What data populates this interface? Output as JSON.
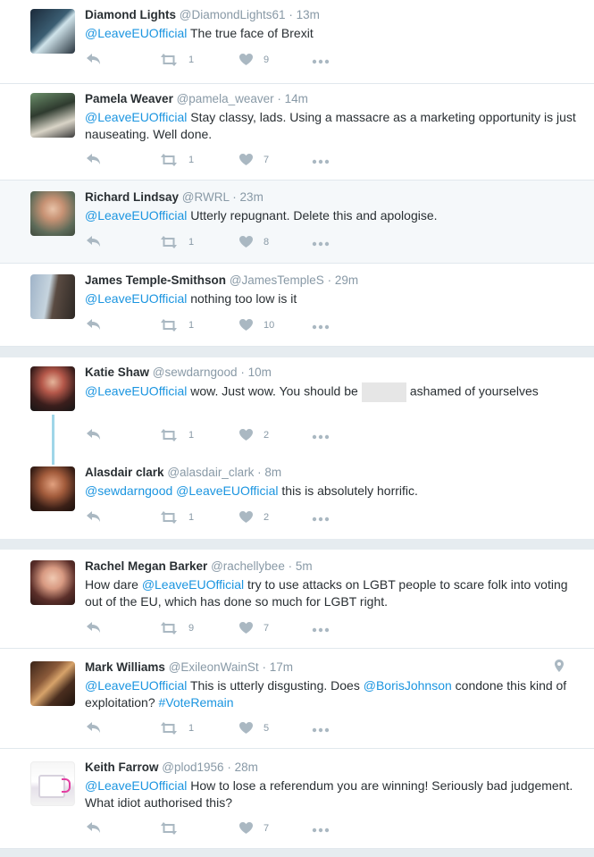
{
  "tweets": [
    {
      "name": "Diamond Lights",
      "handle": "@DiamondLights61",
      "time": "13m",
      "mention": "@LeaveEUOfficial",
      "text": " The true face of Brexit",
      "retweets": "1",
      "likes": "9"
    },
    {
      "name": "Pamela Weaver",
      "handle": "@pamela_weaver",
      "time": "14m",
      "mention": "@LeaveEUOfficial",
      "text": " Stay classy, lads. Using a massacre as a marketing opportunity is just nauseating. Well done.",
      "retweets": "1",
      "likes": "7"
    },
    {
      "name": "Richard Lindsay",
      "handle": "@RWRL",
      "time": "23m",
      "mention": "@LeaveEUOfficial",
      "text": " Utterly repugnant. Delete this and apologise.",
      "retweets": "1",
      "likes": "8"
    },
    {
      "name": "James Temple-Smithson",
      "handle": "@JamesTempleS",
      "time": "29m",
      "mention": "@LeaveEUOfficial",
      "text": " nothing too low is it",
      "retweets": "1",
      "likes": "10"
    },
    {
      "name": "Katie Shaw",
      "handle": "@sewdarngood",
      "time": "10m",
      "mention": "@LeaveEUOfficial",
      "text_a": " wow. Just wow. You should be",
      "text_b": "ashamed of yourselves",
      "retweets": "1",
      "likes": "2"
    },
    {
      "name": "Alasdair clark",
      "handle": "@alasdair_clark",
      "time": "8m",
      "mention1": "@sewdarngood",
      "mention2": "@LeaveEUOfficial",
      "text": " this is absolutely horrific.",
      "retweets": "1",
      "likes": "2"
    },
    {
      "name": "Rachel Megan Barker",
      "handle": "@rachellybee",
      "time": "5m",
      "text_a": "How dare ",
      "mention": "@LeaveEUOfficial",
      "text_b": " try to use attacks on LGBT people to scare folk into voting out of the EU, which has done so much for LGBT right.",
      "retweets": "9",
      "likes": "7"
    },
    {
      "name": "Mark Williams",
      "handle": "@ExileonWainSt",
      "time": "17m",
      "mention": "@LeaveEUOfficial",
      "text_a": " This is utterly disgusting. Does ",
      "mention2": "@BorisJohnson",
      "text_b": " condone this kind of exploitation? ",
      "hashtag": "#VoteRemain",
      "retweets": "1",
      "likes": "5"
    },
    {
      "name": "Keith Farrow",
      "handle": "@plod1956",
      "time": "28m",
      "mention": "@LeaveEUOfficial",
      "text": " How to lose a referendum you are winning! Seriously bad judgement. What idiot authorised this?",
      "retweets": "",
      "likes": "7"
    }
  ],
  "dot": "·",
  "colors": {
    "link": "#1b95e0",
    "icon": "#aab8c2",
    "separator": "#e6ecf0",
    "thread": "#9fd6e8"
  }
}
